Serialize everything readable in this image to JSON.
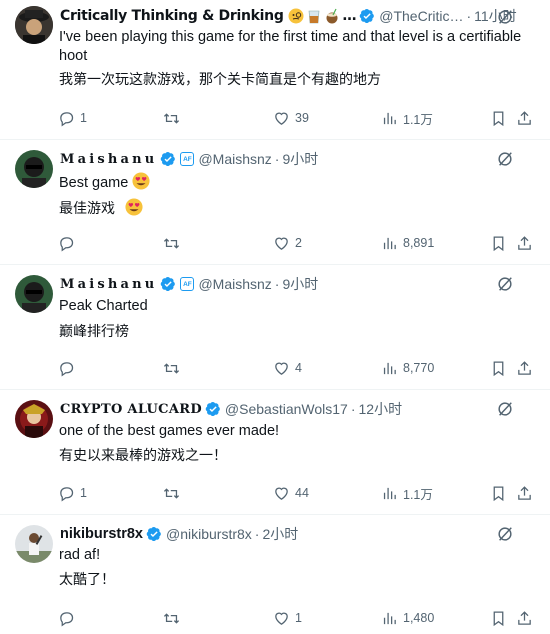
{
  "tweets": [
    {
      "name": "Critically Thinking & Drinking",
      "name_suffix": "…",
      "handle": "@TheCritic…",
      "time": "11小时",
      "text": "I've been playing this game for the first time and that level is a certifiable hoot",
      "translation": "我第一次玩这款游戏，那个关卡简直是个有趣的地方",
      "replies": "1",
      "retweets": "",
      "likes": "39",
      "views": "1.1万"
    },
    {
      "name": "Maishanu",
      "badge": "AF",
      "handle": "@Maishsnz",
      "time": "9小时",
      "text": "Best game",
      "translation": "最佳游戏",
      "replies": "",
      "retweets": "",
      "likes": "2",
      "views": "8,891"
    },
    {
      "name": "Maishanu",
      "badge": "AF",
      "handle": "@Maishsnz",
      "time": "9小时",
      "text": "Peak Charted",
      "translation": "巅峰排行榜",
      "replies": "",
      "retweets": "",
      "likes": "4",
      "views": "8,770"
    },
    {
      "name": "CRYPTO ALUCARD",
      "handle": "@SebastianWols17",
      "time": "12小时",
      "text": "one of the best games ever made!",
      "translation": "有史以来最棒的游戏之一！",
      "replies": "1",
      "retweets": "",
      "likes": "44",
      "views": "1.1万"
    },
    {
      "name": "nikiburstr8x",
      "handle": "@nikiburstr8x",
      "time": "2小时",
      "text": "rad af!",
      "translation": "太酷了！",
      "replies": "",
      "retweets": "",
      "likes": "1",
      "views": "1,480"
    }
  ],
  "separator": "·",
  "colors": {
    "verified": "#1d9bf0",
    "secondary_text": "#536471",
    "divider": "#eff3f4"
  }
}
